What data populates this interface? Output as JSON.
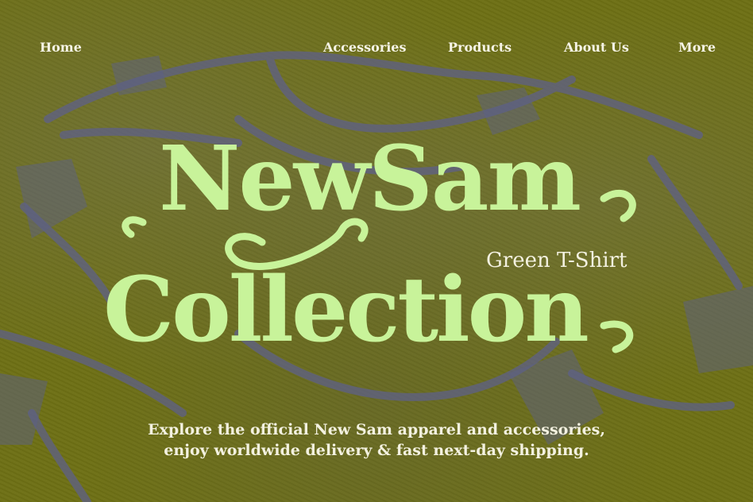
{
  "nav": {
    "items": [
      {
        "label": "Home"
      },
      {
        "label": "Accessories"
      },
      {
        "label": "Products"
      },
      {
        "label": "About Us"
      },
      {
        "label": "More"
      }
    ]
  },
  "hero": {
    "title_line1": "NewSam",
    "title_line2": "Collection",
    "subtitle": "Green T-Shirt",
    "tagline_line1": "Explore the official New Sam apparel and accessories,",
    "tagline_line2": "enjoy worldwide delivery & fast next-day shipping."
  },
  "colors": {
    "background": "#6f7114",
    "headline": "#c8f39a",
    "text": "#f3f1e0",
    "shirt_shadow": "#5c5f86"
  }
}
